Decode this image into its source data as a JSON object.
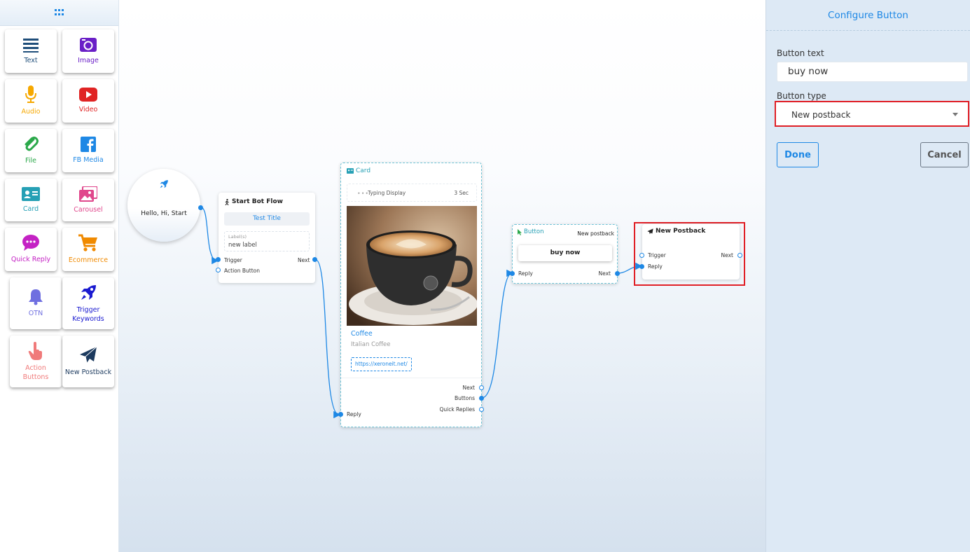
{
  "sidebar": {
    "tools": [
      {
        "label": "Text",
        "icon": "text-lines-icon",
        "color": "#1f4e7a"
      },
      {
        "label": "Image",
        "icon": "image-icon",
        "color": "#6a1fc7"
      },
      {
        "label": "Audio",
        "icon": "microphone-icon",
        "color": "#f6a800"
      },
      {
        "label": "Video",
        "icon": "youtube-icon",
        "color": "#e02424"
      },
      {
        "label": "File",
        "icon": "paperclip-icon",
        "color": "#2ba84a"
      },
      {
        "label": "FB Media",
        "icon": "facebook-icon",
        "color": "#1e88e5"
      },
      {
        "label": "Card",
        "icon": "id-card-icon",
        "color": "#26a0b5"
      },
      {
        "label": "Carousel",
        "icon": "images-icon",
        "color": "#e0478c"
      },
      {
        "label": "Quick Reply",
        "icon": "chat-bubble-icon",
        "color": "#c422c4"
      },
      {
        "label": "Ecommerce",
        "icon": "cart-icon",
        "color": "#f08a00"
      },
      {
        "label": "OTN",
        "icon": "bell-icon",
        "color": "#6f6fe0"
      },
      {
        "label": "Trigger Keywords",
        "icon": "rocket-icon",
        "color": "#1a1ad0"
      },
      {
        "label": "Action Buttons",
        "icon": "pointer-hand-icon",
        "color": "#f07a7a"
      },
      {
        "label": "New Postback",
        "icon": "paper-plane-icon",
        "color": "#1c3a5e"
      }
    ]
  },
  "canvas": {
    "start": {
      "text": "Hello, Hi, Start"
    },
    "start_flow": {
      "title": "Start Bot Flow",
      "test_title": "Test Title",
      "labels_caption": "Label(s)",
      "labels_value": "new label",
      "ports": {
        "trigger": "Trigger",
        "action_button": "Action Button",
        "next": "Next"
      }
    },
    "card": {
      "title": "Card",
      "typing": "Typing Display",
      "typing_time": "3 Sec",
      "item_title": "Coffee",
      "item_subtitle": "Italian Coffee",
      "item_url": "https://xeroneit.net/",
      "ports": {
        "next": "Next",
        "buttons": "Buttons",
        "quick_replies": "Quick Replies",
        "reply": "Reply"
      }
    },
    "button_node": {
      "title": "Button",
      "type": "New postback",
      "button_label": "buy now",
      "ports": {
        "reply": "Reply",
        "next": "Next"
      }
    },
    "postback_node": {
      "title": "New Postback",
      "ports": {
        "trigger": "Trigger",
        "reply": "Reply",
        "next": "Next"
      }
    },
    "colors": {
      "wire": "#1e88e5",
      "highlight": "#e01f26",
      "accent": "#1e88e5"
    }
  },
  "panel": {
    "title": "Configure Button",
    "button_text_label": "Button text",
    "button_text_value": "buy now",
    "button_type_label": "Button type",
    "button_type_value": "New postback",
    "done_label": "Done",
    "cancel_label": "Cancel"
  }
}
